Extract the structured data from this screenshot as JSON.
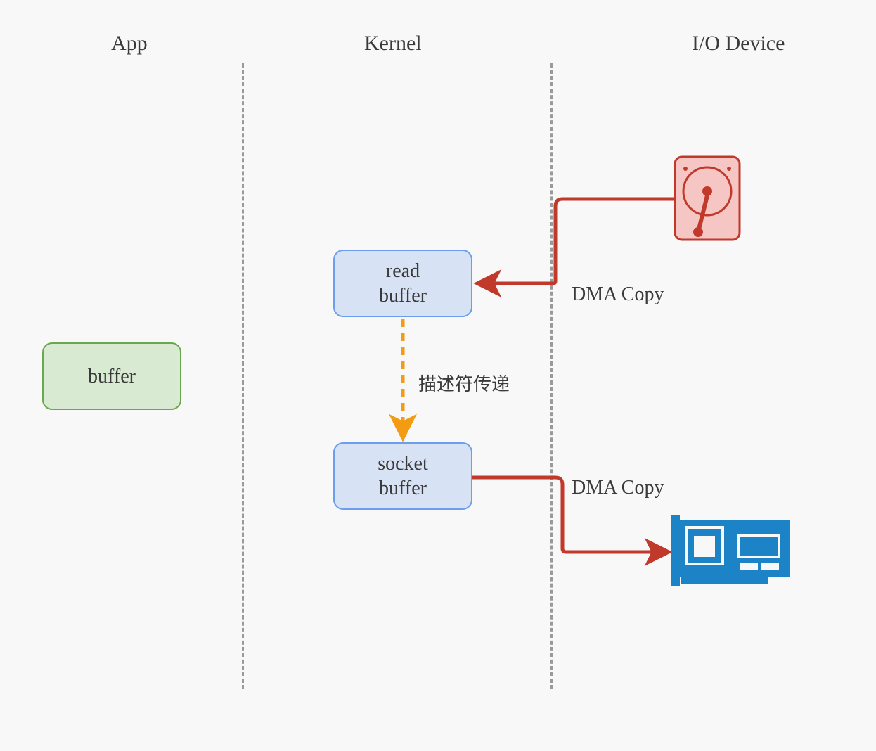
{
  "columns": {
    "app": "App",
    "kernel": "Kernel",
    "io": "I/O Device"
  },
  "boxes": {
    "buffer": "buffer",
    "read_buffer": "read\nbuffer",
    "socket_buffer": "socket\nbuffer"
  },
  "labels": {
    "dma_copy_top": "DMA Copy",
    "dma_copy_bottom": "DMA Copy",
    "descriptor_pass": "描述符传递"
  },
  "icons": {
    "disk": "hard-disk",
    "nic": "network-card"
  },
  "colors": {
    "red_stroke": "#c0392b",
    "red_fill": "#f6c6c4",
    "orange": "#f39c12",
    "blue_nic": "#1b83c6",
    "green_border": "#6aa84f",
    "green_fill": "#d8ead2",
    "blue_border": "#6d9eeb",
    "blue_fill": "#d7e3f4"
  }
}
